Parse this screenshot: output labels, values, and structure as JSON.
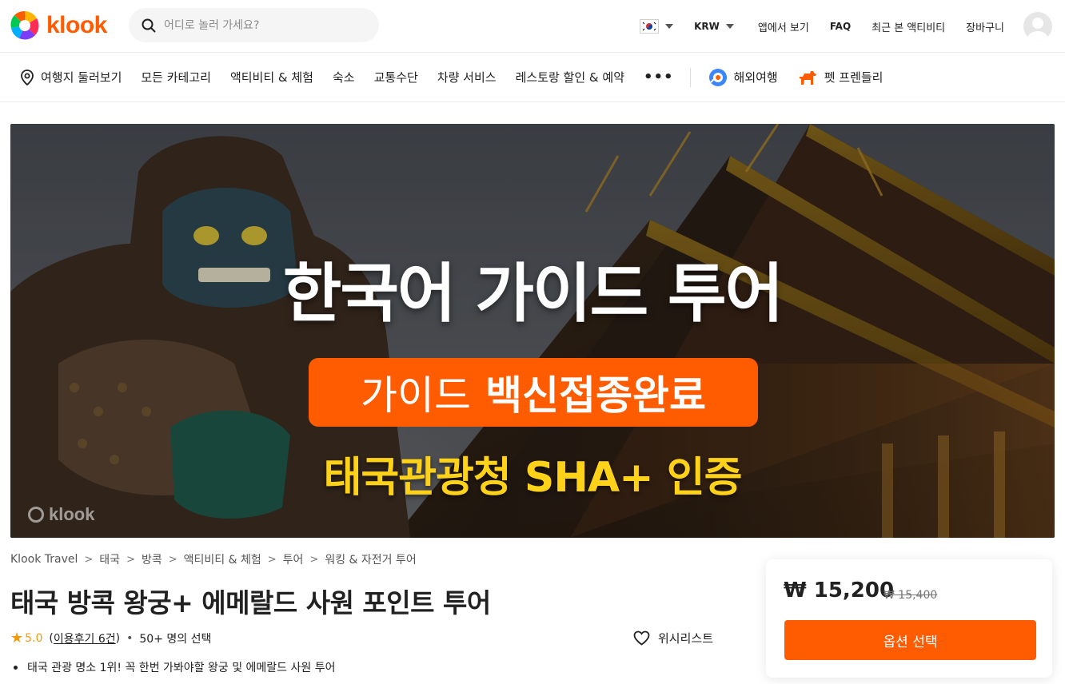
{
  "brand": {
    "name": "klook",
    "color": "#ff5b00"
  },
  "search": {
    "placeholder": "어디로 놀러 가세요?"
  },
  "topbar": {
    "flag_icon": "korea-flag-icon",
    "currency": "KRW",
    "links": [
      "앱에서 보기",
      "FAQ",
      "최근 본 액티비티",
      "장바구니"
    ]
  },
  "catnav": {
    "destination": "여행지 둘러보기",
    "items": [
      "모든 카테고리",
      "액티비티 & 체험",
      "숙소",
      "교통수단",
      "차량 서비스",
      "레스토랑 할인 & 예약"
    ],
    "more": "•••",
    "special": [
      "해외여행",
      "펫 프렌들리"
    ]
  },
  "hero": {
    "headline": "한국어 가이드 투어",
    "badge_light": "가이드",
    "badge_bold": "백신접종완료",
    "subline": "태국관광청 SHA+ 인증",
    "watermark": "klook",
    "colors": {
      "badge": "#ff5b00",
      "subline": "#ffd21a"
    }
  },
  "breadcrumb": [
    "Klook Travel",
    "태국",
    "방콕",
    "액티비티 & 체험",
    "투어",
    "워킹 & 자전거 투어"
  ],
  "product": {
    "title": "태국 방콕 왕궁+ 에메랄드 사원 포인트 투어",
    "rating": "5.0",
    "review_open": "(",
    "review_link": "이용후기 6건",
    "review_close": ")",
    "separator": "•",
    "booked": "50+ 명의 선택",
    "wishlist": "위시리스트",
    "highlight": "태국 관광 명소 1위! 꼭 한번 가봐야할 왕궁 및 에메랄드 사원 투어"
  },
  "price": {
    "current": "₩ 15,200",
    "original": "₩ 15,400",
    "button": "옵션 선택"
  }
}
